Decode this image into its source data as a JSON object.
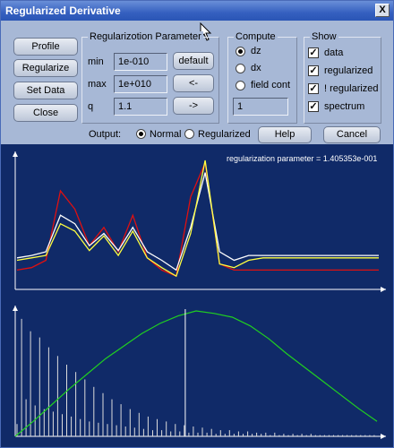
{
  "window": {
    "title": "Regularized Derivative",
    "close_glyph": "X"
  },
  "left_buttons": [
    "Profile",
    "Regularize",
    "Set Data",
    "Close"
  ],
  "param_group": {
    "title": "Regularizotion Parameter",
    "min_label": "min",
    "min_value": "1e-010",
    "max_label": "max",
    "max_value": "1e+010",
    "q_label": "q",
    "q_value": "1.1",
    "default_button": "default",
    "left_button": "<-",
    "right_button": "->"
  },
  "compute_group": {
    "title": "Compute",
    "options": [
      "dz",
      "dx",
      "field cont"
    ],
    "selected": "dz",
    "value": "1"
  },
  "show_group": {
    "title": "Show",
    "items": [
      {
        "label": "data",
        "checked": true
      },
      {
        "label": "regularized",
        "checked": true
      },
      {
        "label": "! regularized",
        "checked": true
      },
      {
        "label": "spectrum",
        "checked": true
      }
    ]
  },
  "output": {
    "label": "Output:",
    "options": [
      "Normal",
      "Regularized"
    ],
    "selected": "Normal"
  },
  "help_button": "Help",
  "cancel_button": "Cancel",
  "plot": {
    "parameter_text": "regularization parameter = 1.405353e-001",
    "colors": {
      "background": "#102a68",
      "axes": "#ffffff",
      "red": "#e01010",
      "white": "#ffffff",
      "yellow": "#ffff40",
      "green": "#20d020",
      "bars": "#dcdcdc"
    }
  },
  "chart_data": [
    {
      "type": "line",
      "title": "",
      "xlabel": "",
      "ylabel": "",
      "x": [
        0,
        4,
        8,
        12,
        16,
        20,
        24,
        28,
        32,
        36,
        40,
        44,
        48,
        52,
        56,
        60,
        64,
        68,
        72,
        76,
        80,
        84,
        88,
        92,
        96,
        100
      ],
      "series": [
        {
          "color": "red",
          "values": [
            0.1,
            0.12,
            0.18,
            0.75,
            0.6,
            0.3,
            0.45,
            0.25,
            0.55,
            0.2,
            0.1,
            0.05,
            0.7,
            0.98,
            0.15,
            0.1,
            0.1,
            0.1,
            0.1,
            0.1,
            0.1,
            0.1,
            0.1,
            0.1,
            0.1,
            0.1
          ]
        },
        {
          "color": "white",
          "values": [
            0.2,
            0.22,
            0.25,
            0.55,
            0.48,
            0.3,
            0.4,
            0.26,
            0.45,
            0.25,
            0.18,
            0.1,
            0.45,
            0.9,
            0.25,
            0.18,
            0.22,
            0.22,
            0.22,
            0.22,
            0.22,
            0.22,
            0.22,
            0.22,
            0.22,
            0.22
          ]
        },
        {
          "color": "yellow",
          "values": [
            0.18,
            0.2,
            0.22,
            0.48,
            0.42,
            0.26,
            0.38,
            0.22,
            0.42,
            0.2,
            0.12,
            0.05,
            0.4,
            1.0,
            0.15,
            0.12,
            0.18,
            0.2,
            0.2,
            0.2,
            0.2,
            0.2,
            0.2,
            0.2,
            0.2,
            0.2
          ]
        }
      ]
    },
    {
      "type": "bar",
      "title": "",
      "xlabel": "",
      "ylabel": "",
      "values": [
        0.1,
        0.95,
        0.3,
        0.85,
        0.25,
        0.8,
        0.22,
        0.72,
        0.2,
        0.65,
        0.18,
        0.58,
        0.16,
        0.52,
        0.14,
        0.46,
        0.12,
        0.4,
        0.11,
        0.35,
        0.1,
        0.3,
        0.09,
        0.26,
        0.08,
        0.22,
        0.07,
        0.19,
        0.06,
        0.16,
        0.05,
        0.14,
        0.05,
        0.12,
        0.04,
        0.1,
        0.04,
        0.09,
        0.03,
        0.08,
        0.03,
        0.07,
        0.03,
        0.06,
        0.02,
        0.05,
        0.02,
        0.05,
        0.02,
        0.04,
        0.02,
        0.04,
        0.02,
        0.03,
        0.02,
        0.03,
        0.01,
        0.03,
        0.01,
        0.02,
        0.01,
        0.02,
        0.01,
        0.02,
        0.01,
        0.02,
        0.01,
        0.01,
        0.01,
        0.01,
        0.01,
        0.01,
        0.01,
        0.01,
        0.01,
        0.01,
        0.01,
        0.01,
        0.01,
        0.01
      ],
      "curve": {
        "x": [
          0,
          0.05,
          0.1,
          0.15,
          0.2,
          0.25,
          0.3,
          0.35,
          0.4,
          0.45,
          0.5,
          0.55,
          0.6,
          0.65,
          0.7,
          0.75,
          0.8,
          0.85,
          0.9,
          0.95,
          1.0
        ],
        "values": [
          0.0,
          0.12,
          0.25,
          0.38,
          0.5,
          0.62,
          0.72,
          0.82,
          0.9,
          0.96,
          1.0,
          0.98,
          0.95,
          0.88,
          0.78,
          0.66,
          0.55,
          0.44,
          0.33,
          0.22,
          0.12
        ]
      },
      "marker_x": 0.47
    }
  ]
}
